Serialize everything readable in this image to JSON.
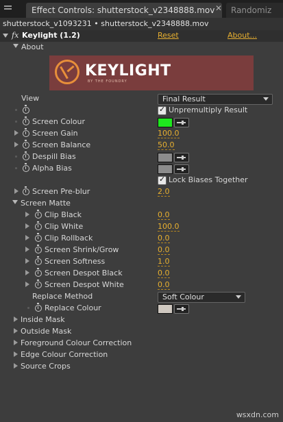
{
  "tabs": {
    "active": "Effect Controls: shutterstock_v2348888.mov",
    "inactive": "Randomiz"
  },
  "breadcrumb": "shutterstock_v1093231 • shutterstock_v2348888.mov",
  "effect": {
    "fx": "fx",
    "name": "Keylight (1.2)",
    "reset": "Reset",
    "about": "About..."
  },
  "about_label": "About",
  "logo": {
    "text": "KEYLIGHT",
    "subtext": "BY THE FOUNDRY"
  },
  "view": {
    "label": "View",
    "value": "Final Result"
  },
  "unpremultiply": {
    "label": "Unpremultiply Result",
    "checked": true
  },
  "screen_colour": {
    "label": "Screen Colour",
    "color": "#1ee81e"
  },
  "screen_gain": {
    "label": "Screen Gain",
    "value": "100.0"
  },
  "screen_balance": {
    "label": "Screen Balance",
    "value": "50.0"
  },
  "despill_bias": {
    "label": "Despill Bias",
    "color": "#8c8c8c"
  },
  "alpha_bias": {
    "label": "Alpha Bias",
    "color": "#8c8c8c"
  },
  "lock_biases": {
    "label": "Lock Biases Together",
    "checked": true
  },
  "screen_preblur": {
    "label": "Screen Pre-blur",
    "value": "2.0"
  },
  "screen_matte": {
    "label": "Screen Matte",
    "items": [
      {
        "label": "Clip Black",
        "value": "0.0"
      },
      {
        "label": "Clip White",
        "value": "100.0"
      },
      {
        "label": "Clip Rollback",
        "value": "0.0"
      },
      {
        "label": "Screen Shrink/Grow",
        "value": "0.0"
      },
      {
        "label": "Screen Softness",
        "value": "1.0"
      },
      {
        "label": "Screen Despot Black",
        "value": "0.0"
      },
      {
        "label": "Screen Despot White",
        "value": "0.0"
      }
    ],
    "replace_method": {
      "label": "Replace Method",
      "value": "Soft Colour"
    },
    "replace_colour": {
      "label": "Replace Colour",
      "color": "#cfc8c0"
    }
  },
  "groups": [
    "Inside Mask",
    "Outside Mask",
    "Foreground Colour Correction",
    "Edge Colour Correction",
    "Source Crops"
  ],
  "watermark": "wsxdn.com"
}
